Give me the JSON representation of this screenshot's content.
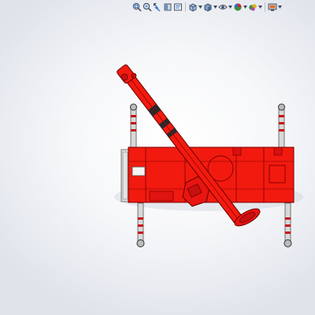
{
  "toolbar": {
    "buttons": [
      {
        "name": "zoom-to-fit-button",
        "icon": "zoom-to-fit-icon"
      },
      {
        "name": "zoom-to-area-button",
        "icon": "zoom-to-area-icon"
      },
      {
        "name": "previous-view-button",
        "icon": "previous-view-icon"
      },
      {
        "name": "section-view-button",
        "icon": "section-view-icon"
      },
      {
        "name": "dynamic-annotation-views-button",
        "icon": "dynamic-annotation-icon"
      },
      {
        "name": "view-orientation-button",
        "icon": "view-orientation-cube-icon",
        "has_dropdown": true
      },
      {
        "name": "display-style-button",
        "icon": "display-style-icon",
        "has_dropdown": true
      },
      {
        "name": "hide-show-items-button",
        "icon": "hide-show-eye-icon",
        "has_dropdown": true
      },
      {
        "name": "edit-appearance-button",
        "icon": "appearance-sphere-icon",
        "has_dropdown": true
      },
      {
        "name": "apply-scene-button",
        "icon": "scene-icon",
        "has_dropdown": true
      },
      {
        "name": "view-settings-button",
        "icon": "view-settings-monitor-icon",
        "has_dropdown": true
      }
    ]
  },
  "model": {
    "name": "crane-model",
    "body_color": "#f21a0f",
    "edge_color": "#7a0000",
    "outrigger_color": "#d8d8d8",
    "stripe_color": "#c81010"
  }
}
